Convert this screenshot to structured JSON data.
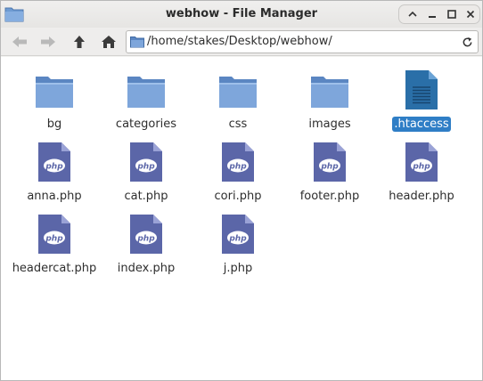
{
  "window": {
    "title": "webhow - File Manager",
    "controls": [
      "raise",
      "minimize",
      "maximize",
      "close"
    ]
  },
  "toolbar": {
    "buttons": [
      "back-arrow-icon",
      "forward-arrow-icon",
      "up-arrow-icon",
      "home-icon"
    ],
    "path": "/home/stakes/Desktop/webhow/",
    "reload_icon": "reload-icon"
  },
  "files": [
    {
      "name": "bg",
      "type": "folder"
    },
    {
      "name": "categories",
      "type": "folder"
    },
    {
      "name": "css",
      "type": "folder"
    },
    {
      "name": "images",
      "type": "folder"
    },
    {
      "name": ".htaccess",
      "type": "text",
      "selected": true
    },
    {
      "name": "anna.php",
      "type": "php"
    },
    {
      "name": "cat.php",
      "type": "php"
    },
    {
      "name": "cori.php",
      "type": "php"
    },
    {
      "name": "footer.php",
      "type": "php"
    },
    {
      "name": "header.php",
      "type": "php"
    },
    {
      "name": "headercat.php",
      "type": "php"
    },
    {
      "name": "index.php",
      "type": "php"
    },
    {
      "name": "j.php",
      "type": "php"
    }
  ],
  "icon_badge_text": "php",
  "colors": {
    "folder": "#6e9bd2",
    "php_page": "#5b66a8",
    "selection": "#2f7ec6",
    "text_file": "#2a6fa8"
  }
}
